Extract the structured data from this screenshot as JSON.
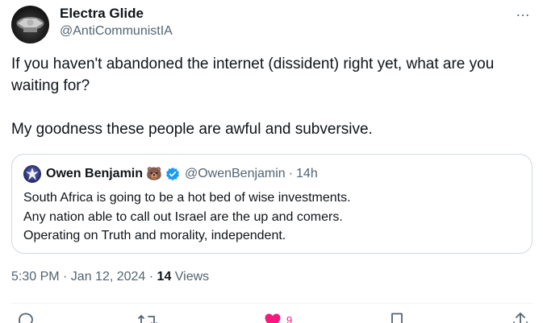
{
  "author": {
    "display_name": "Electra Glide",
    "handle": "@AntiCommunistIA"
  },
  "more_icon": "…",
  "tweet": {
    "text": "If you haven't abandoned the internet (dissident) right yet, what are you waiting for?\n\nMy goodness these people are awful and subversive."
  },
  "quoted_tweet": {
    "display_name": "Owen Benjamin",
    "emoji": "🐻",
    "handle": "@OwenBenjamin",
    "separator": "·",
    "time": "14h",
    "lines": [
      "South Africa is going to be a hot bed of wise investments.",
      "Any nation able to call out Israel are the up and comers.",
      "Operating on Truth and morality, independent."
    ]
  },
  "meta": {
    "timestamp": "5:30 PM · Jan 12, 2024 · ",
    "views_count": "14",
    "views_label": " Views"
  },
  "actions": {
    "reply_icon": "reply-icon",
    "retweet_icon": "retweet-icon",
    "like_icon": "heart-icon",
    "like_count": "9",
    "bookmark_icon": "bookmark-icon",
    "share_icon": "share-icon"
  },
  "colors": {
    "text": "#0f1419",
    "secondary": "#536471",
    "border": "#cfd9de",
    "verified": "#1d9bf0",
    "like": "#f91880"
  }
}
